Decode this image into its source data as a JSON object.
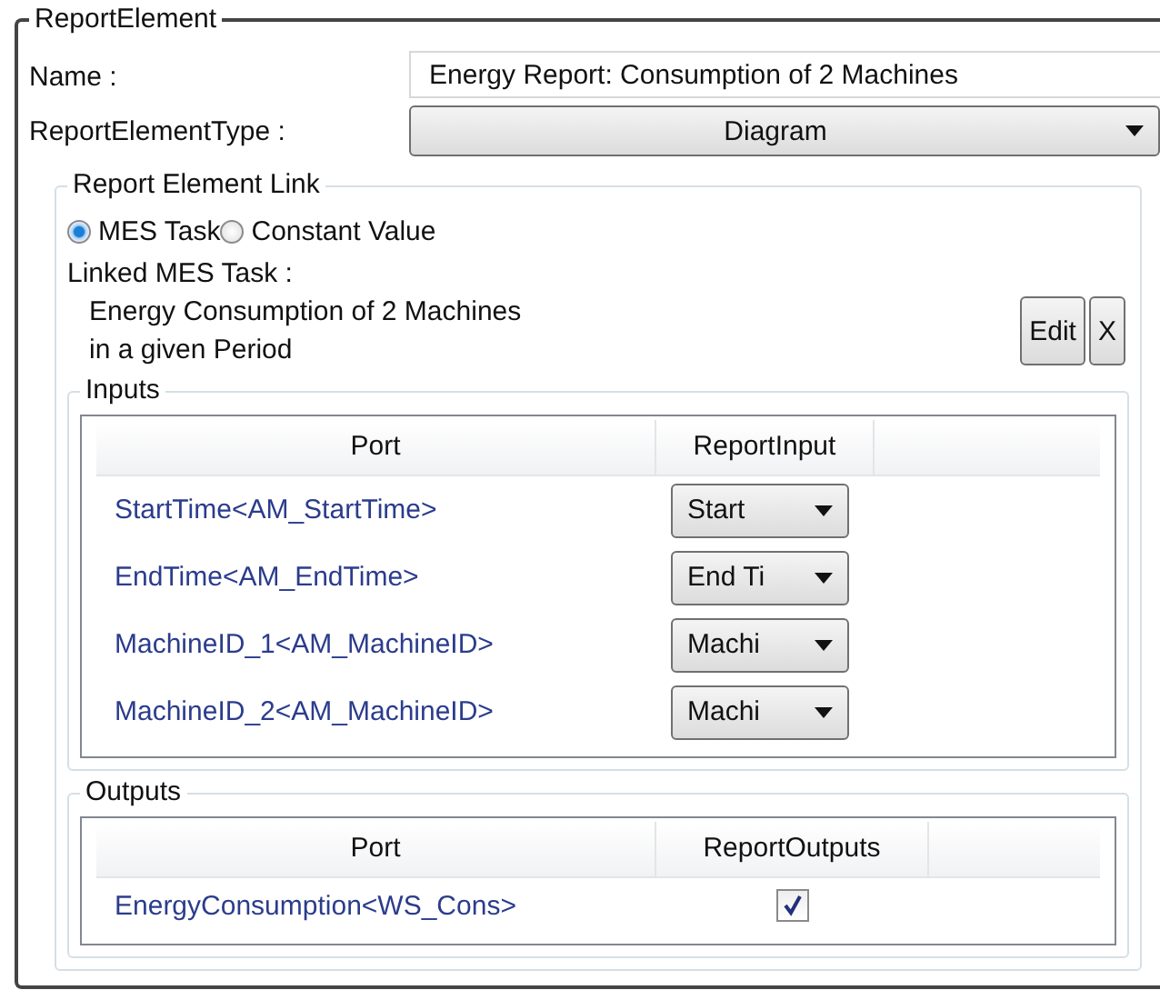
{
  "group": {
    "title": "ReportElement"
  },
  "name_field": {
    "label": "Name :",
    "value": "Energy Report: Consumption of 2 Machines"
  },
  "type_field": {
    "label": "ReportElementType :",
    "value": "Diagram"
  },
  "link": {
    "title": "Report Element Link",
    "options": [
      {
        "label": "MES Task",
        "selected": true
      },
      {
        "label": "Constant Value",
        "selected": false
      }
    ],
    "linked_label": "Linked MES Task :",
    "linked_task": "Energy Consumption of 2 Machines in a given Period",
    "buttons": [
      "Edit",
      "X"
    ]
  },
  "inputs": {
    "title": "Inputs",
    "columns": [
      "Port",
      "ReportInput"
    ],
    "rows": [
      {
        "port": "StartTime<AM_StartTime>",
        "input": "Start"
      },
      {
        "port": "EndTime<AM_EndTime>",
        "input": "End Ti"
      },
      {
        "port": "MachineID_1<AM_MachineID>",
        "input": "Machi"
      },
      {
        "port": "MachineID_2<AM_MachineID>",
        "input": "Machi"
      }
    ]
  },
  "outputs": {
    "title": "Outputs",
    "columns": [
      "Port",
      "ReportOutputs"
    ],
    "rows": [
      {
        "port": "EnergyConsumption<WS_Cons>",
        "checked": true
      }
    ]
  }
}
